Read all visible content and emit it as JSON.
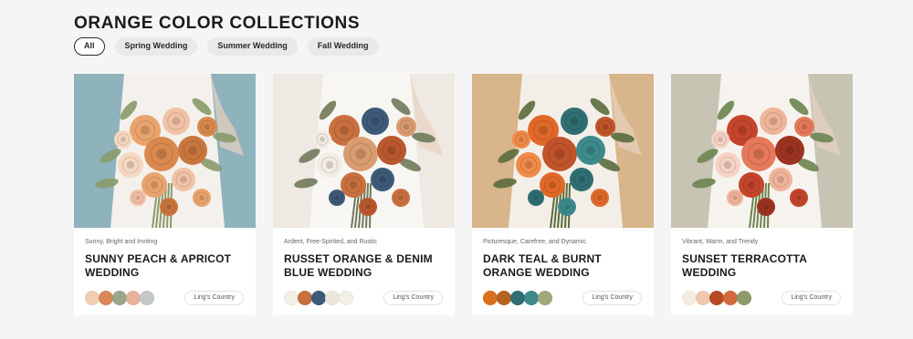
{
  "page": {
    "title": "ORANGE COLOR COLLECTIONS"
  },
  "filters": [
    {
      "label": "All",
      "active": true
    },
    {
      "label": "Spring Wedding",
      "active": false
    },
    {
      "label": "Summer Wedding",
      "active": false
    },
    {
      "label": "Fall Wedding",
      "active": false
    }
  ],
  "cards": [
    {
      "subtitle": "Sunny, Bright and Inviting",
      "title": "SUNNY PEACH & APRICOT WEDDING",
      "brand": "Ling's Country",
      "swatches": [
        "#f2cdb6",
        "#d9885a",
        "#9aa78a",
        "#e9b199",
        "#c4c9c6"
      ],
      "image": {
        "bg": "#8fb3bd",
        "dress": "#f4f1ec",
        "flowers": [
          "#e9a46e",
          "#f2c2a6",
          "#d9894e",
          "#f6d8c2",
          "#c9763e"
        ],
        "leaf": "#8a9a6a"
      }
    },
    {
      "subtitle": "Ardent, Free-Spirited, and Rustic",
      "title": "RUSSET ORANGE & DENIM BLUE WEDDING",
      "brand": "Ling's Country",
      "swatches": [
        "#f3eee6",
        "#c9703f",
        "#3e5a78",
        "#ece7dc",
        "#f1efe8"
      ],
      "image": {
        "bg": "#eee9e2",
        "dress": "#f8f6f2",
        "flowers": [
          "#c9703f",
          "#3e5a78",
          "#d99b70",
          "#f2ece2",
          "#b9582e"
        ],
        "leaf": "#6f7a5a"
      }
    },
    {
      "subtitle": "Picturesque, Carefree, and Dynamic",
      "title": "DARK TEAL & BURNT ORANGE WEDDING",
      "brand": "Ling's Country",
      "swatches": [
        "#d8701f",
        "#b8621f",
        "#2f6f73",
        "#3e8a8c",
        "#a3a77a"
      ],
      "image": {
        "bg": "#d8b58a",
        "dress": "#f3efe8",
        "flowers": [
          "#e0692a",
          "#2f6f73",
          "#c0532a",
          "#f08a4a",
          "#3e8a8c"
        ],
        "leaf": "#5b6b3c"
      }
    },
    {
      "subtitle": "Vibrant, Warm, and Trendy",
      "title": "SUNSET TERRACOTTA WEDDING",
      "brand": "Ling's Country",
      "swatches": [
        "#f6ece2",
        "#f1c9ae",
        "#b94a25",
        "#d46a3b",
        "#8f9a6a"
      ],
      "image": {
        "bg": "#c7c4b4",
        "dress": "#f6f3ee",
        "flowers": [
          "#c4452c",
          "#f0b49a",
          "#e5795a",
          "#f6d3c4",
          "#9c3320"
        ],
        "leaf": "#6d8450"
      }
    }
  ]
}
